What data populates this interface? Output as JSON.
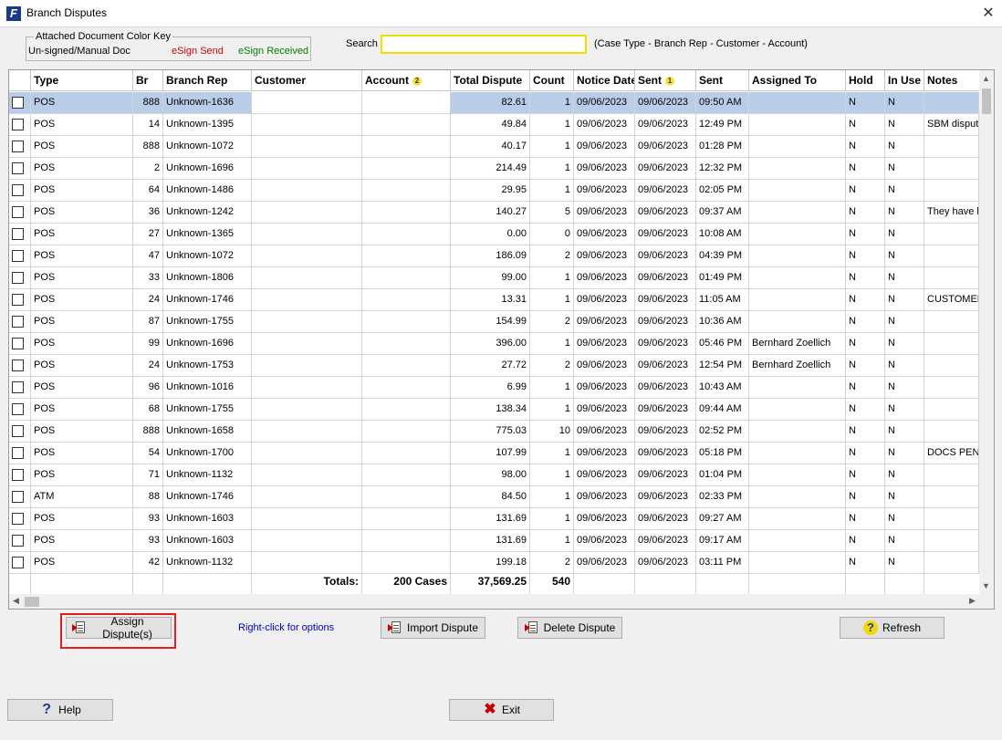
{
  "window": {
    "title": "Branch Disputes",
    "close_glyph": "✕"
  },
  "color_key": {
    "legend": "Attached Document Color Key",
    "unsigned": "Un-signed/Manual  Doc",
    "esign_send": "eSign Send",
    "esign_received": "eSign Received",
    "colors": {
      "unsigned": "#000000",
      "esign_send": "#d00000",
      "esign_received": "#008000"
    }
  },
  "search": {
    "label": "Search",
    "value": "",
    "hint": "(Case Type - Branch Rep - Customer - Account)"
  },
  "table": {
    "columns": [
      "Type",
      "Br",
      "Branch Rep",
      "Customer",
      "Account",
      "Total Dispute",
      "Count",
      "Notice Date",
      "Sent",
      "Sent",
      "Assigned To",
      "Hold",
      "In Use",
      "Notes"
    ],
    "sort_badges": {
      "account": "2",
      "sent": "1"
    },
    "rows": [
      {
        "type": "POS",
        "br": "888",
        "rep": "Unknown-1636",
        "customer": "",
        "account": "",
        "total": "82.61",
        "count": "1",
        "notice": "09/06/2023",
        "sent_date": "09/06/2023",
        "sent_time": "09:50 AM",
        "assigned": "",
        "hold": "N",
        "inuse": "N",
        "notes": ""
      },
      {
        "type": "POS",
        "br": "14",
        "rep": "Unknown-1395",
        "customer": "",
        "account": "",
        "total": "49.84",
        "count": "1",
        "notice": "09/06/2023",
        "sent_date": "09/06/2023",
        "sent_time": "12:49 PM",
        "assigned": "",
        "hold": "N",
        "inuse": "N",
        "notes": "SBM dispute"
      },
      {
        "type": "POS",
        "br": "888",
        "rep": "Unknown-1072",
        "customer": "",
        "account": "",
        "total": "40.17",
        "count": "1",
        "notice": "09/06/2023",
        "sent_date": "09/06/2023",
        "sent_time": "01:28 PM",
        "assigned": "",
        "hold": "N",
        "inuse": "N",
        "notes": ""
      },
      {
        "type": "POS",
        "br": "2",
        "rep": "Unknown-1696",
        "customer": "",
        "account": "",
        "total": "214.49",
        "count": "1",
        "notice": "09/06/2023",
        "sent_date": "09/06/2023",
        "sent_time": "12:32 PM",
        "assigned": "",
        "hold": "N",
        "inuse": "N",
        "notes": ""
      },
      {
        "type": "POS",
        "br": "64",
        "rep": "Unknown-1486",
        "customer": "",
        "account": "",
        "total": "29.95",
        "count": "1",
        "notice": "09/06/2023",
        "sent_date": "09/06/2023",
        "sent_time": "02:05 PM",
        "assigned": "",
        "hold": "N",
        "inuse": "N",
        "notes": ""
      },
      {
        "type": "POS",
        "br": "36",
        "rep": "Unknown-1242",
        "customer": "",
        "account": "",
        "total": "140.27",
        "count": "5",
        "notice": "09/06/2023",
        "sent_date": "09/06/2023",
        "sent_time": "09:37 AM",
        "assigned": "",
        "hold": "N",
        "inuse": "N",
        "notes": "They have b"
      },
      {
        "type": "POS",
        "br": "27",
        "rep": "Unknown-1365",
        "customer": "",
        "account": "",
        "total": "0.00",
        "count": "0",
        "notice": "09/06/2023",
        "sent_date": "09/06/2023",
        "sent_time": "10:08 AM",
        "assigned": "",
        "hold": "N",
        "inuse": "N",
        "notes": ""
      },
      {
        "type": "POS",
        "br": "47",
        "rep": "Unknown-1072",
        "customer": "",
        "account": "",
        "total": "186.09",
        "count": "2",
        "notice": "09/06/2023",
        "sent_date": "09/06/2023",
        "sent_time": "04:39 PM",
        "assigned": "",
        "hold": "N",
        "inuse": "N",
        "notes": ""
      },
      {
        "type": "POS",
        "br": "33",
        "rep": "Unknown-1806",
        "customer": "",
        "account": "",
        "total": "99.00",
        "count": "1",
        "notice": "09/06/2023",
        "sent_date": "09/06/2023",
        "sent_time": "01:49 PM",
        "assigned": "",
        "hold": "N",
        "inuse": "N",
        "notes": ""
      },
      {
        "type": "POS",
        "br": "24",
        "rep": "Unknown-1746",
        "customer": "",
        "account": "",
        "total": "13.31",
        "count": "1",
        "notice": "09/06/2023",
        "sent_date": "09/06/2023",
        "sent_time": "11:05 AM",
        "assigned": "",
        "hold": "N",
        "inuse": "N",
        "notes": "CUSTOMER"
      },
      {
        "type": "POS",
        "br": "87",
        "rep": "Unknown-1755",
        "customer": "",
        "account": "",
        "total": "154.99",
        "count": "2",
        "notice": "09/06/2023",
        "sent_date": "09/06/2023",
        "sent_time": "10:36 AM",
        "assigned": "",
        "hold": "N",
        "inuse": "N",
        "notes": ""
      },
      {
        "type": "POS",
        "br": "99",
        "rep": "Unknown-1696",
        "customer": "",
        "account": "",
        "total": "396.00",
        "count": "1",
        "notice": "09/06/2023",
        "sent_date": "09/06/2023",
        "sent_time": "05:46 PM",
        "assigned": "Bernhard Zoellich",
        "hold": "N",
        "inuse": "N",
        "notes": ""
      },
      {
        "type": "POS",
        "br": "24",
        "rep": "Unknown-1753",
        "customer": "",
        "account": "",
        "total": "27.72",
        "count": "2",
        "notice": "09/06/2023",
        "sent_date": "09/06/2023",
        "sent_time": "12:54 PM",
        "assigned": "Bernhard Zoellich",
        "hold": "N",
        "inuse": "N",
        "notes": ""
      },
      {
        "type": "POS",
        "br": "96",
        "rep": "Unknown-1016",
        "customer": "",
        "account": "",
        "total": "6.99",
        "count": "1",
        "notice": "09/06/2023",
        "sent_date": "09/06/2023",
        "sent_time": "10:43 AM",
        "assigned": "",
        "hold": "N",
        "inuse": "N",
        "notes": ""
      },
      {
        "type": "POS",
        "br": "68",
        "rep": "Unknown-1755",
        "customer": "",
        "account": "",
        "total": "138.34",
        "count": "1",
        "notice": "09/06/2023",
        "sent_date": "09/06/2023",
        "sent_time": "09:44 AM",
        "assigned": "",
        "hold": "N",
        "inuse": "N",
        "notes": ""
      },
      {
        "type": "POS",
        "br": "888",
        "rep": "Unknown-1658",
        "customer": "",
        "account": "",
        "total": "775.03",
        "count": "10",
        "notice": "09/06/2023",
        "sent_date": "09/06/2023",
        "sent_time": "02:52 PM",
        "assigned": "",
        "hold": "N",
        "inuse": "N",
        "notes": ""
      },
      {
        "type": "POS",
        "br": "54",
        "rep": "Unknown-1700",
        "customer": "",
        "account": "",
        "total": "107.99",
        "count": "1",
        "notice": "09/06/2023",
        "sent_date": "09/06/2023",
        "sent_time": "05:18 PM",
        "assigned": "",
        "hold": "N",
        "inuse": "N",
        "notes": "DOCS PEND"
      },
      {
        "type": "POS",
        "br": "71",
        "rep": "Unknown-1132",
        "customer": "",
        "account": "",
        "total": "98.00",
        "count": "1",
        "notice": "09/06/2023",
        "sent_date": "09/06/2023",
        "sent_time": "01:04 PM",
        "assigned": "",
        "hold": "N",
        "inuse": "N",
        "notes": ""
      },
      {
        "type": "ATM",
        "br": "88",
        "rep": "Unknown-1746",
        "customer": "",
        "account": "",
        "total": "84.50",
        "count": "1",
        "notice": "09/06/2023",
        "sent_date": "09/06/2023",
        "sent_time": "02:33 PM",
        "assigned": "",
        "hold": "N",
        "inuse": "N",
        "notes": ""
      },
      {
        "type": "POS",
        "br": "93",
        "rep": "Unknown-1603",
        "customer": "",
        "account": "",
        "total": "131.69",
        "count": "1",
        "notice": "09/06/2023",
        "sent_date": "09/06/2023",
        "sent_time": "09:27 AM",
        "assigned": "",
        "hold": "N",
        "inuse": "N",
        "notes": ""
      },
      {
        "type": "POS",
        "br": "93",
        "rep": "Unknown-1603",
        "customer": "",
        "account": "",
        "total": "131.69",
        "count": "1",
        "notice": "09/06/2023",
        "sent_date": "09/06/2023",
        "sent_time": "09:17 AM",
        "assigned": "",
        "hold": "N",
        "inuse": "N",
        "notes": ""
      },
      {
        "type": "POS",
        "br": "42",
        "rep": "Unknown-1132",
        "customer": "",
        "account": "",
        "total": "199.18",
        "count": "2",
        "notice": "09/06/2023",
        "sent_date": "09/06/2023",
        "sent_time": "03:11 PM",
        "assigned": "",
        "hold": "N",
        "inuse": "N",
        "notes": ""
      }
    ],
    "selected_row": 0,
    "totals": {
      "label": "Totals:",
      "cases": "200 Cases",
      "total_dispute": "37,569.25",
      "count": "540"
    }
  },
  "buttons": {
    "assign": "Assign Dispute(s)",
    "right_click_hint": "Right-click for options",
    "import": "Import Dispute",
    "delete": "Delete Dispute",
    "refresh": "Refresh",
    "help": "Help",
    "exit": "Exit"
  },
  "colors": {
    "accent_search_border": "#f0e000",
    "selected_row": "#b9cde8",
    "highlight": "#e02020",
    "hint_link": "#0000c8"
  }
}
